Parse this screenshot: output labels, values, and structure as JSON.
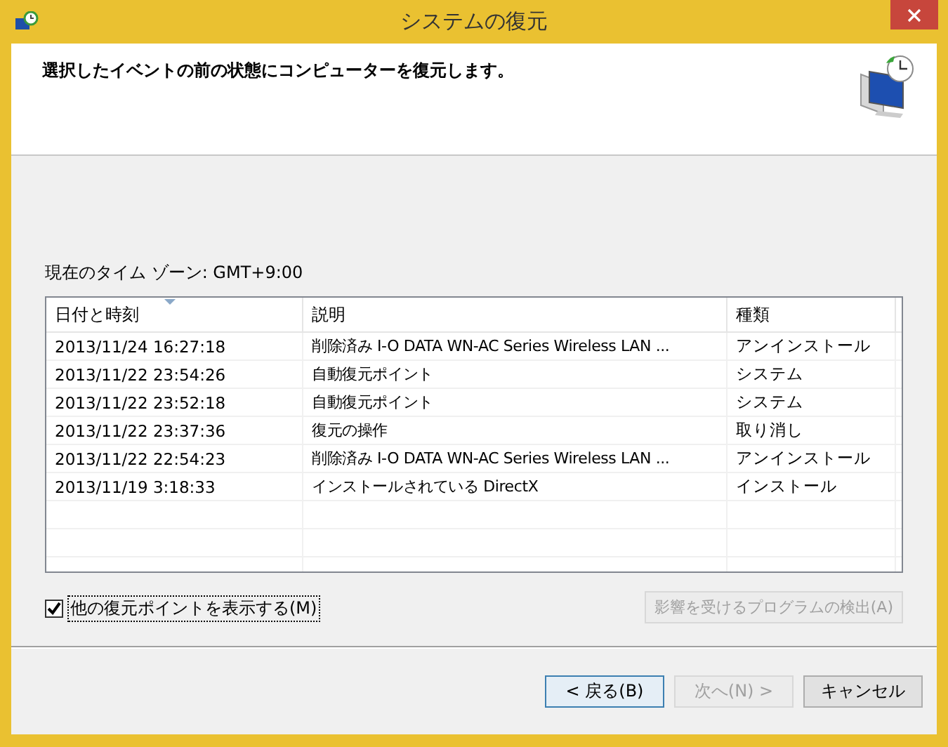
{
  "window": {
    "title": "システムの復元"
  },
  "header": {
    "instruction": "選択したイベントの前の状態にコンピューターを復元します。"
  },
  "timezone": "現在のタイム ゾーン: GMT+9:00",
  "table": {
    "columns": [
      {
        "label": "日付と時刻",
        "sorted": true
      },
      {
        "label": "説明",
        "sorted": false
      },
      {
        "label": "種類",
        "sorted": false
      }
    ],
    "rows": [
      {
        "cells": [
          "2013/11/24 16:27:18",
          "削除済み I-O DATA WN-AC Series Wireless LAN ...",
          "アンインストール"
        ]
      },
      {
        "cells": [
          "2013/11/22 23:54:26",
          "自動復元ポイント",
          "システム"
        ]
      },
      {
        "cells": [
          "2013/11/22 23:52:18",
          "自動復元ポイント",
          "システム"
        ]
      },
      {
        "cells": [
          "2013/11/22 23:37:36",
          "復元の操作",
          "取り消し"
        ]
      },
      {
        "cells": [
          "2013/11/22 22:54:23",
          "削除済み I-O DATA WN-AC Series Wireless LAN ...",
          "アンインストール"
        ]
      },
      {
        "cells": [
          "2013/11/19 3:18:33",
          "インストールされている DirectX",
          "インストール"
        ]
      }
    ]
  },
  "show_more": {
    "label": "他の復元ポイントを表示する(M)",
    "checked": true
  },
  "scan_button": {
    "label": "影響を受けるプログラムの検出(A)",
    "disabled": true
  },
  "buttons": [
    {
      "label": "< 戻る(B)",
      "disabled": false,
      "default": true
    },
    {
      "label": "次へ(N) >",
      "disabled": true,
      "default": false
    },
    {
      "label": "キャンセル",
      "disabled": false,
      "default": false
    }
  ]
}
